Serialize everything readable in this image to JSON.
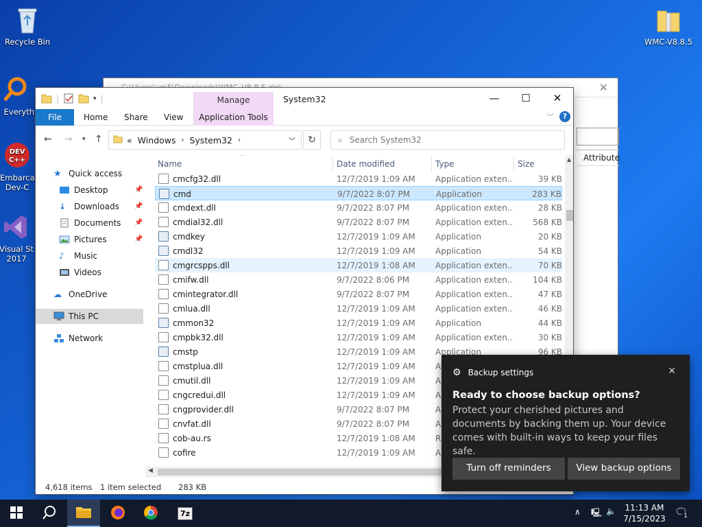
{
  "desktop": {
    "icons": [
      {
        "label": "Recycle Bin"
      },
      {
        "label": "Everyth"
      },
      {
        "label": "Embarca Dev-C"
      },
      {
        "label": "Visual St 2017"
      },
      {
        "label": "WMC-V8.8.5"
      }
    ]
  },
  "background_window": {
    "title": "C:\\Users\\vm5\\Downloads\\WMC_V8.8.5.zip\\",
    "column_header": "Attribute"
  },
  "explorer": {
    "title": "System32",
    "manage_tab": "Manage",
    "ribbon_tabs": {
      "file": "File",
      "home": "Home",
      "share": "Share",
      "view": "View",
      "application_tools": "Application Tools"
    },
    "address": {
      "prefix": "«",
      "crumb1": "Windows",
      "crumb2": "System32"
    },
    "search_placeholder": "Search System32",
    "nav": {
      "quick_access": "Quick access",
      "desktop": "Desktop",
      "downloads": "Downloads",
      "documents": "Documents",
      "pictures": "Pictures",
      "music": "Music",
      "videos": "Videos",
      "onedrive": "OneDrive",
      "this_pc": "This PC",
      "network": "Network"
    },
    "columns": {
      "name": "Name",
      "date": "Date modified",
      "type": "Type",
      "size": "Size"
    },
    "files": [
      {
        "name": "cmcfg32.dll",
        "date": "12/7/2019 1:09 AM",
        "type": "Application exten...",
        "size": "39 KB"
      },
      {
        "name": "cmd",
        "date": "9/7/2022 8:07 PM",
        "type": "Application",
        "size": "283 KB"
      },
      {
        "name": "cmdext.dll",
        "date": "9/7/2022 8:07 PM",
        "type": "Application exten...",
        "size": "28 KB"
      },
      {
        "name": "cmdial32.dll",
        "date": "9/7/2022 8:07 PM",
        "type": "Application exten...",
        "size": "568 KB"
      },
      {
        "name": "cmdkey",
        "date": "12/7/2019 1:09 AM",
        "type": "Application",
        "size": "20 KB"
      },
      {
        "name": "cmdl32",
        "date": "12/7/2019 1:09 AM",
        "type": "Application",
        "size": "54 KB"
      },
      {
        "name": "cmgrcspps.dll",
        "date": "12/7/2019 1:08 AM",
        "type": "Application exten...",
        "size": "70 KB"
      },
      {
        "name": "cmifw.dll",
        "date": "9/7/2022 8:06 PM",
        "type": "Application exten...",
        "size": "104 KB"
      },
      {
        "name": "cmintegrator.dll",
        "date": "9/7/2022 8:07 PM",
        "type": "Application exten...",
        "size": "47 KB"
      },
      {
        "name": "cmlua.dll",
        "date": "12/7/2019 1:09 AM",
        "type": "Application exten...",
        "size": "46 KB"
      },
      {
        "name": "cmmon32",
        "date": "12/7/2019 1:09 AM",
        "type": "Application",
        "size": "44 KB"
      },
      {
        "name": "cmpbk32.dll",
        "date": "12/7/2019 1:09 AM",
        "type": "Application exten...",
        "size": "30 KB"
      },
      {
        "name": "cmstp",
        "date": "12/7/2019 1:09 AM",
        "type": "Application",
        "size": "96 KB"
      },
      {
        "name": "cmstplua.dll",
        "date": "12/7/2019 1:09 AM",
        "type": "A",
        "size": ""
      },
      {
        "name": "cmutil.dll",
        "date": "12/7/2019 1:09 AM",
        "type": "A",
        "size": ""
      },
      {
        "name": "cngcredui.dll",
        "date": "12/7/2019 1:09 AM",
        "type": "A",
        "size": ""
      },
      {
        "name": "cngprovider.dll",
        "date": "9/7/2022 8:07 PM",
        "type": "A",
        "size": ""
      },
      {
        "name": "cnvfat.dll",
        "date": "9/7/2022 8:07 PM",
        "type": "A",
        "size": ""
      },
      {
        "name": "cob-au.rs",
        "date": "12/7/2019 1:08 AM",
        "type": "RS",
        "size": ""
      },
      {
        "name": "cofire",
        "date": "12/7/2019 1:09 AM",
        "type": "A",
        "size": ""
      }
    ],
    "status": {
      "items": "4,618 items",
      "selected": "1 item selected",
      "selected_size": "283 KB"
    }
  },
  "toast": {
    "header": "Backup settings",
    "title": "Ready to choose backup options?",
    "body": "Protect your cherished pictures and documents by backing them up. Your device comes with built-in ways to keep your files safe.",
    "button_off": "Turn off reminders",
    "button_view": "View backup options"
  },
  "taskbar": {
    "time": "11:13 AM",
    "date": "7/15/2023",
    "notifications": "1",
    "app_7z": "7z"
  },
  "colors": {
    "accent": "#1979ca",
    "selected": "#cce8ff",
    "manage": "#f2d9f6",
    "toast_bg": "#1f1f1f"
  }
}
